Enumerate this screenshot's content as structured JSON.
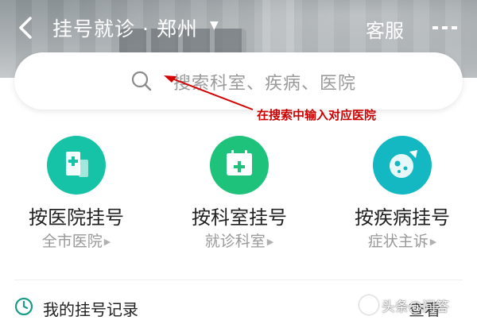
{
  "header": {
    "title": "挂号就诊 · 郑州",
    "service_label": "客服",
    "icons": {
      "back": "chevron-left-icon",
      "dropdown": "caret-down-icon",
      "more": "more-dots-icon"
    }
  },
  "search": {
    "placeholder": "搜索科室、疾病、医院",
    "icon": "search-icon"
  },
  "annotation": {
    "text": "在搜索中输入对应医院",
    "color": "#cc0000"
  },
  "categories": [
    {
      "label": "按医院挂号",
      "sub": "全市医院",
      "icon": "hospital-icon",
      "color": "#17c3a6"
    },
    {
      "label": "按科室挂号",
      "sub": "就诊科室",
      "icon": "calendar-plus-icon",
      "color": "#1ec27a"
    },
    {
      "label": "按疾病挂号",
      "sub": "症状主诉",
      "icon": "virus-icon",
      "color": "#14b8c2"
    }
  ],
  "records": {
    "label": "我的挂号记录",
    "view_label": "查看",
    "icon": "clock-icon",
    "accent": "#1a9b87"
  },
  "watermark": "头条@问答"
}
